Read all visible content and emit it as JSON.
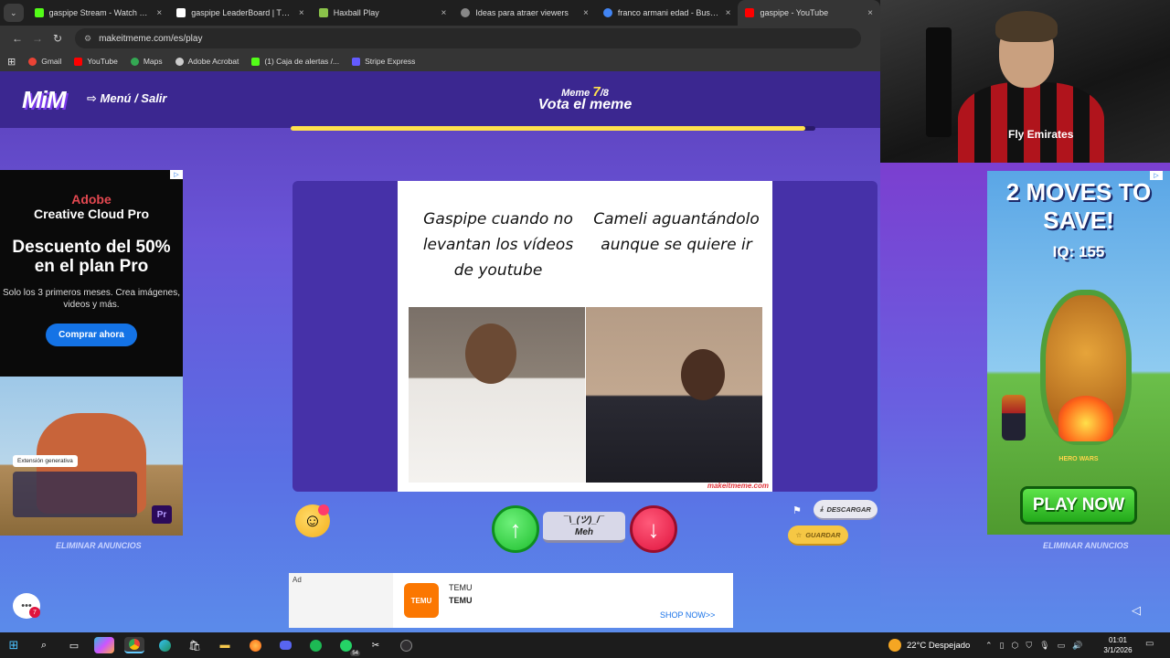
{
  "browser": {
    "tabs": [
      {
        "label": "gaspipe Stream - Watch Live on",
        "color": "#53fc18"
      },
      {
        "label": "gaspipe LeaderBoard | The best",
        "color": "#ffffff"
      },
      {
        "label": "Haxball Play",
        "color": "#8bc34a"
      },
      {
        "label": "Ideas para atraer viewers",
        "color": "#cccccc"
      },
      {
        "label": "franco armani edad - Buscar con",
        "color": "#4285f4"
      },
      {
        "label": "gaspipe - YouTube",
        "color": "#ff0000"
      }
    ],
    "close_glyph": "×",
    "url": "makeitmeme.com/es/play",
    "bookmarks": [
      {
        "label": "Gmail",
        "color": "#ea4335"
      },
      {
        "label": "YouTube",
        "color": "#ff0000"
      },
      {
        "label": "Maps",
        "color": "#34a853"
      },
      {
        "label": "Adobe Acrobat",
        "color": "#cccccc"
      },
      {
        "label": "(1) Caja de alertas /...",
        "color": "#53fc18"
      },
      {
        "label": "Stripe Express",
        "color": "#635bff"
      }
    ]
  },
  "webcam": {
    "shirt_text": "Fly Emirates"
  },
  "game": {
    "logo": "MiM",
    "menu_label": "Menú / Salir",
    "meme_label": "Meme",
    "meme_current": "7",
    "meme_total": "/8",
    "title": "Vota el meme",
    "progress": 0.98,
    "meme": {
      "caption_left": "Gaspipe cuando no levantan los vídeos de youtube",
      "caption_right": "Cameli aguantándolo aunque se quiere ir",
      "watermark": "makeitmeme.com"
    },
    "meh_face": "¯\\_(ツ)_/¯",
    "meh_label": "Meh",
    "download_label": "DESCARGAR",
    "save_label": "GUARDAR",
    "remove_ads": "ELIMINAR ANUNCIOS"
  },
  "ad_left": {
    "brand": "Adobe",
    "product": "Creative Cloud Pro",
    "headline": "Descuento del 50% en el plan Pro",
    "body": "Solo los 3 primeros meses. Crea imágenes, videos y más.",
    "cta": "Comprar ahora",
    "chip": "Extensión generativa",
    "badge": "Pr"
  },
  "ad_right": {
    "headline": "2 MOVES TO SAVE!",
    "iq": "IQ: 155",
    "brand": "HERO WARS",
    "cta": "PLAY NOW"
  },
  "ad_bottom": {
    "tag": "Ad",
    "logo": "TEMU",
    "title": "TEMU",
    "subtitle": "TEMU",
    "cta": "SHOP NOW>>"
  },
  "chat_badge": "7",
  "taskbar": {
    "weather": "22°C  Despejado",
    "time": "01:01",
    "date": "3/1/2026",
    "whatsapp_badge": "54"
  }
}
